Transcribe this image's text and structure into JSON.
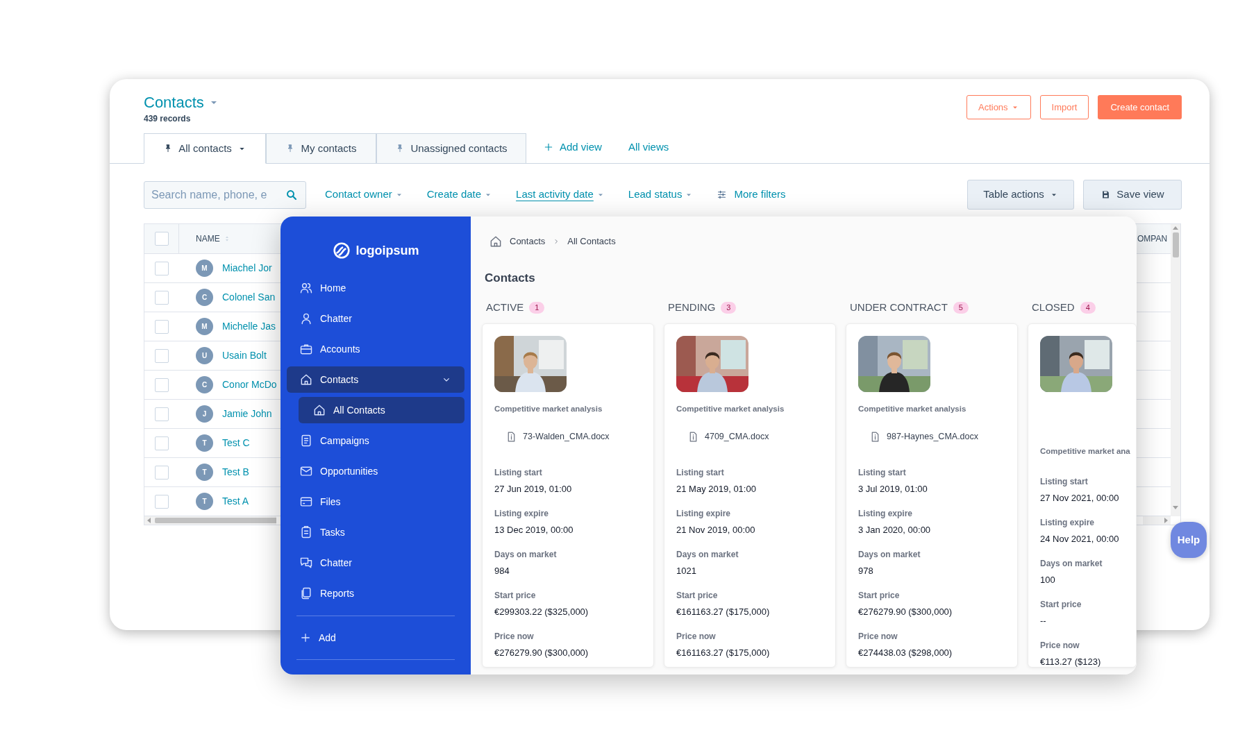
{
  "back_window": {
    "title": "Contacts",
    "subtitle": "439 records",
    "header_buttons": [
      {
        "label": "Actions",
        "kind": "outline",
        "caret": true
      },
      {
        "label": "Import",
        "kind": "outline",
        "caret": false
      },
      {
        "label": "Create contact",
        "kind": "primary",
        "caret": false
      }
    ],
    "view_tabs": [
      {
        "label": "All contacts",
        "selected": true
      },
      {
        "label": "My contacts",
        "selected": false
      },
      {
        "label": "Unassigned contacts",
        "selected": false
      }
    ],
    "view_links": [
      {
        "label": "Add view",
        "kind": "add"
      },
      {
        "label": "All views",
        "kind": "plain"
      }
    ],
    "search": {
      "placeholder": "Search name, phone, e"
    },
    "filters": [
      {
        "label": "Contact owner",
        "kind": "dropdown",
        "underlined": false
      },
      {
        "label": "Create date",
        "kind": "dropdown",
        "underlined": false
      },
      {
        "label": "Last activity date",
        "kind": "dropdown",
        "underlined": true
      },
      {
        "label": "Lead status",
        "kind": "dropdown",
        "underlined": false
      },
      {
        "label": "More filters",
        "kind": "more",
        "underlined": false
      }
    ],
    "table_buttons": [
      {
        "label": "Table actions",
        "kind": "dropdown"
      },
      {
        "label": "Save view",
        "kind": "save"
      }
    ],
    "table": {
      "all_checked": false,
      "columns": [
        "NAME",
        "OMPAN"
      ],
      "rows": [
        {
          "initial": "M",
          "name": "Miachel Jor",
          "checked": false
        },
        {
          "initial": "C",
          "name": "Colonel San",
          "checked": false
        },
        {
          "initial": "M",
          "name": "Michelle Jas",
          "checked": false
        },
        {
          "initial": "U",
          "name": "Usain Bolt",
          "checked": false
        },
        {
          "initial": "C",
          "name": "Conor McDo",
          "checked": false
        },
        {
          "initial": "J",
          "name": "Jamie John",
          "checked": false
        },
        {
          "initial": "T",
          "name": "Test C",
          "checked": false
        },
        {
          "initial": "T",
          "name": "Test B",
          "checked": false
        },
        {
          "initial": "T",
          "name": "Test A",
          "checked": false
        }
      ]
    }
  },
  "app": {
    "logo": "logoipsum",
    "nav": [
      {
        "label": "Home",
        "selected": false
      },
      {
        "label": "Chatter",
        "selected": false
      },
      {
        "label": "Accounts",
        "selected": false
      },
      {
        "label": "Contacts",
        "selected": true,
        "expanded": true,
        "children": [
          {
            "label": "All Contacts",
            "selected": true
          }
        ]
      },
      {
        "label": "Campaigns",
        "selected": false
      },
      {
        "label": "Opportunities",
        "selected": false
      },
      {
        "label": "Files",
        "selected": false
      },
      {
        "label": "Tasks",
        "selected": false
      },
      {
        "label": "Chatter",
        "selected": false
      },
      {
        "label": "Reports",
        "selected": false
      }
    ],
    "add": "Add",
    "breadcrumb": [
      "Contacts",
      "All Contacts"
    ],
    "heading": "Contacts",
    "columns": [
      {
        "title": "ACTIVE",
        "count": "1",
        "card": {
          "label": "Competitive market analysis",
          "file": "73-Walden_CMA.docx",
          "fields": [
            {
              "label": "Listing start",
              "value": "27 Jun 2019, 01:00"
            },
            {
              "label": "Listing expire",
              "value": "13 Dec 2019, 00:00"
            },
            {
              "label": "Days on market",
              "value": "984"
            },
            {
              "label": "Start price",
              "value": "€299303.22 ($325,000)"
            },
            {
              "label": "Price now",
              "value": "€276279.90 ($300,000)"
            }
          ]
        }
      },
      {
        "title": "PENDING",
        "count": "3",
        "card": {
          "label": "Competitive market analysis",
          "file": "4709_CMA.docx",
          "fields": [
            {
              "label": "Listing start",
              "value": "21 May 2019, 01:00"
            },
            {
              "label": "Listing expire",
              "value": "21 Nov 2019, 00:00"
            },
            {
              "label": "Days on market",
              "value": "1021"
            },
            {
              "label": "Start price",
              "value": "€161163.27 ($175,000)"
            },
            {
              "label": "Price now",
              "value": "€161163.27 ($175,000)"
            }
          ]
        }
      },
      {
        "title": "UNDER CONTRACT",
        "count": "5",
        "card": {
          "label": "Competitive market analysis",
          "file": "987-Haynes_CMA.docx",
          "fields": [
            {
              "label": "Listing start",
              "value": "3 Jul 2019, 01:00"
            },
            {
              "label": "Listing expire",
              "value": "3 Jan 2020, 00:00"
            },
            {
              "label": "Days on market",
              "value": "978"
            },
            {
              "label": "Start price",
              "value": "€276279.90 ($300,000)"
            },
            {
              "label": "Price now",
              "value": "€274438.03 ($298,000)"
            }
          ]
        }
      },
      {
        "title": "CLOSED",
        "count": "4",
        "card": {
          "label": "Competitive market ana",
          "fields": [
            {
              "label": "Listing start",
              "value": "27 Nov 2021, 00:00"
            },
            {
              "label": "Listing expire",
              "value": "24 Nov 2021, 00:00"
            },
            {
              "label": "Days on market",
              "value": "100"
            },
            {
              "label": "Start price",
              "value": "--"
            },
            {
              "label": "Price now",
              "value": "€113.27 ($123)"
            }
          ]
        }
      }
    ]
  },
  "help": "Help"
}
